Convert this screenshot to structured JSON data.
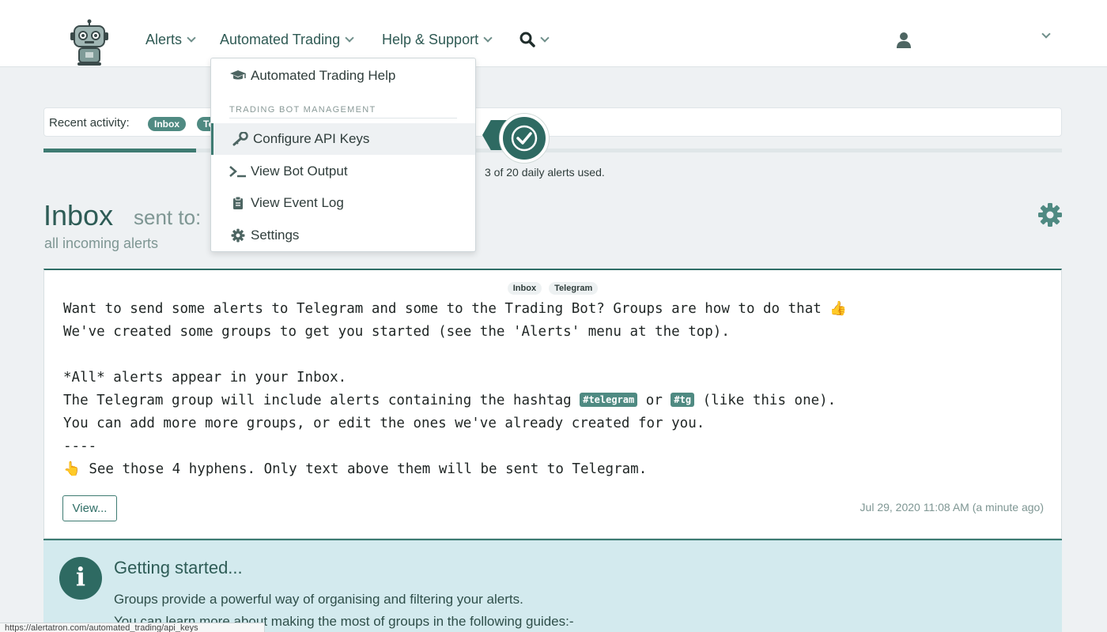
{
  "nav": {
    "items": [
      {
        "label": "Alerts"
      },
      {
        "label": "Automated Trading"
      },
      {
        "label": "Help & Support"
      }
    ]
  },
  "recent": {
    "label": "Recent activity:",
    "pills": [
      "Inbox",
      "Te"
    ]
  },
  "usage": {
    "text": "3 of 20 daily alerts used.",
    "fraction": 0.15
  },
  "inbox": {
    "title": "Inbox",
    "sent_to": "sent to:",
    "subtitle": "all incoming alerts"
  },
  "alert": {
    "tags": [
      "Inbox",
      "Telegram"
    ],
    "line1": "Want to send some alerts to Telegram and some to the Trading Bot? Groups are how to do that 👍",
    "line2": "We've created some groups to get you started (see the 'Alerts' menu at the top).",
    "line3": "",
    "line4": "*All* alerts appear in your Inbox.",
    "line5_pre": "The Telegram group will include alerts containing the hashtag ",
    "hashtag1": "#telegram",
    "line5_mid": " or ",
    "hashtag2": "#tg",
    "line5_post": " (like this one).",
    "line6": "You can add more more groups, or edit the ones we've already created for you.",
    "line7": "----",
    "line8": "👆 See those 4 hyphens. Only text above them will be sent to Telegram.",
    "view_label": "View...",
    "timestamp": "Jul 29, 2020 11:08 AM (a minute ago)"
  },
  "getting_started": {
    "title": "Getting started...",
    "line1": "Groups provide a powerful way of organising and filtering your alerts.",
    "line2": "You can learn more about making the most of groups in the following guides:-"
  },
  "dropdown": {
    "help_label": "Automated Trading Help",
    "section_header": "TRADING BOT MANAGEMENT",
    "items": [
      {
        "label": "Configure API Keys",
        "icon": "key-icon"
      },
      {
        "label": "View Bot Output",
        "icon": "terminal-icon"
      },
      {
        "label": "View Event Log",
        "icon": "clipboard-icon"
      },
      {
        "label": "Settings",
        "icon": "gear-icon"
      }
    ]
  },
  "status_url": "https://alertatron.com/automated_trading/api_keys",
  "colors": {
    "primary": "#2e6a62",
    "accent": "#3e7b72",
    "info_bg": "#d3eaee"
  }
}
